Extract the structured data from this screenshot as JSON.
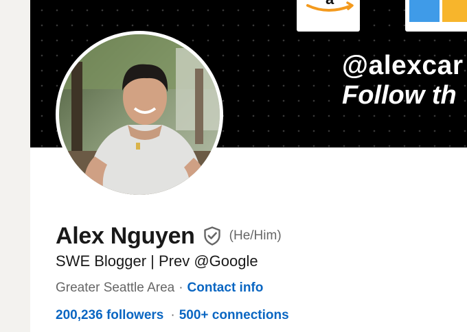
{
  "banner": {
    "handle": "@alexcar",
    "tagline": "Follow th"
  },
  "profile": {
    "name": "Alex Nguyen",
    "pronouns": "(He/Him)",
    "headline": "SWE Blogger | Prev @Google",
    "location": "Greater Seattle Area",
    "separator": "·",
    "contact_info": "Contact info",
    "followers": "200,236 followers",
    "connections": "500+ connections"
  },
  "colors": {
    "link": "#0a66c2",
    "banner_bg": "#000000",
    "text_primary": "#191919",
    "text_secondary": "#666666"
  },
  "icons": [
    "verified-shield-icon",
    "amazon-logo",
    "microsoft-logo"
  ]
}
